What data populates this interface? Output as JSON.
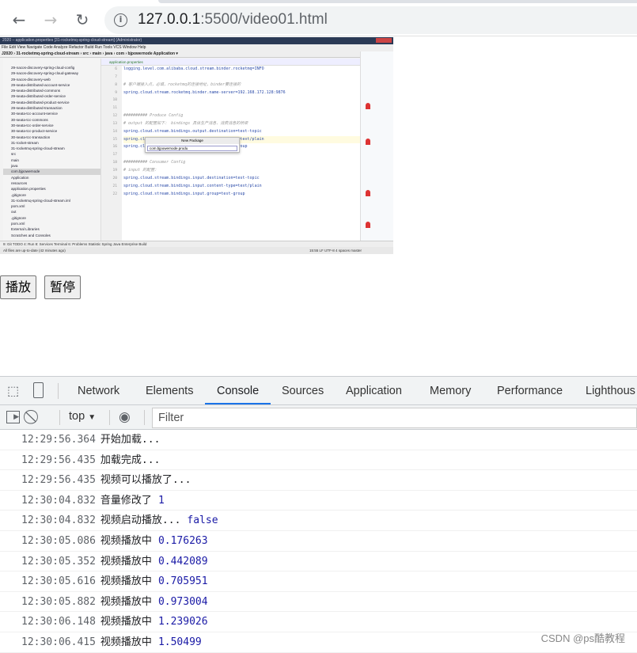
{
  "browser": {
    "url_host": "127.0.0.1",
    "url_rest": ":5500/video01.html",
    "icons": [
      "back-arrow-icon",
      "forward-arrow-icon",
      "reload-icon",
      "info-icon"
    ]
  },
  "video": {
    "window_title": "2020 – application.properties [31-rocketmq-spring-cloud-stream] (Administrator)",
    "menu": "File  Edit  View  Navigate  Code  Analyze  Refactor  Build  Run  Tools  VCS  Window  Help",
    "nav": "J2020 › 31-rocketmq-spring-cloud-stream › src › main › java › com › bjpowernode        Application ▾",
    "editor_tab": "application.properties",
    "tree": [
      "29-nacos-discovery-spring-cloud-config",
      "29-nacos-discovery-spring-cloud-gateway",
      "29-nacos-discovery-web",
      "29-seata-distributed-account-service",
      "29-seata-distributed-commons",
      "29-seata-distributed-order-service",
      "29-seata-distributed-product-service",
      "29-seata-distributed-transaction",
      "30-seata-tcc-account-service",
      "30-seata-tcc-commons",
      "30-seata-tcc-order-service",
      "30-seata-tcc-product-service",
      "30-seata-tcc-transaction",
      "31-rocket-stream",
      "31-rocketmq-spring-cloud-stream",
      "  src",
      "    main",
      "      java",
      "        com.bjpowernode",
      "          Application",
      "      resources",
      "        application.properties",
      "  .gitignore",
      "  31-rocketmq-spring-cloud-stream.iml",
      "  pom.xml",
      "out",
      ".gitignore",
      "pom.xml",
      "External Libraries",
      "Scratches and Consoles"
    ],
    "line_numbers": [
      "6",
      "7",
      "8",
      "9",
      "10",
      "11",
      "12",
      "13",
      "14",
      "15",
      "16",
      "17",
      "18",
      "19",
      "20",
      "21",
      "22"
    ],
    "code": [
      "logging.level.com.alibaba.cloud.stream.binder.rocketmq=INFO",
      "",
      "# 客户端接入点，必填，rocketmq的连接地址，binder要连接的",
      "spring.cloud.stream.rocketmq.binder.name-server=192.168.172.128:9876",
      "",
      "",
      "########## Produce Config",
      "# output 的配置如下： bindings 具体生产消息、消费消息的桥梁",
      "spring.cloud.stream.bindings.output.destination=test-topic",
      "spring.cloud.stream.bindings.output.content-type=text/plain",
      "spring.cloud.stream.bindings.output.group=test-group",
      "",
      "########## Consumer Config",
      "# input 的配置：",
      "spring.cloud.stream.bindings.input.destination=test-topic",
      "spring.cloud.stream.bindings.input.content-type=text/plain",
      "spring.cloud.stream.bindings.input.group=test-group"
    ],
    "popup_title": "New Package",
    "popup_value": "com.bjpowernode.produ",
    "bottom_tools": "9: Git   TODO   4: Run   8: Services   Terminal   6: Problems   Statistic   Spring   Java Enterprise   Build",
    "status": "All files are up-to-date (42 minutes ago)",
    "status_right": "15:55  LF  UTF-8  4 spaces  master"
  },
  "buttons": {
    "play": "播放",
    "pause": "暂停"
  },
  "devtools": {
    "tabs": [
      "Network",
      "Elements",
      "Console",
      "Sources",
      "Application",
      "Memory",
      "Performance",
      "Lighthous"
    ],
    "active_tab": "Console",
    "context": "top",
    "filter_placeholder": "Filter",
    "accent": "#1a73e8",
    "logs": [
      {
        "time": "12:29:56.364",
        "msg": "开始加载...",
        "val": ""
      },
      {
        "time": "12:29:56.435",
        "msg": "加载完成...",
        "val": ""
      },
      {
        "time": "12:29:56.435",
        "msg": "视频可以播放了...",
        "val": ""
      },
      {
        "time": "12:30:04.832",
        "msg": "音量修改了",
        "val": "1"
      },
      {
        "time": "12:30:04.832",
        "msg": "视频启动播放...",
        "val": "false"
      },
      {
        "time": "12:30:05.086",
        "msg": "视频播放中",
        "val": "0.176263"
      },
      {
        "time": "12:30:05.352",
        "msg": "视频播放中",
        "val": "0.442089"
      },
      {
        "time": "12:30:05.616",
        "msg": "视频播放中",
        "val": "0.705951"
      },
      {
        "time": "12:30:05.882",
        "msg": "视频播放中",
        "val": "0.973004"
      },
      {
        "time": "12:30:06.148",
        "msg": "视频播放中",
        "val": "1.239026"
      },
      {
        "time": "12:30:06.415",
        "msg": "视频播放中",
        "val": "1.50499"
      }
    ]
  },
  "watermark": "CSDN @ps酷教程"
}
